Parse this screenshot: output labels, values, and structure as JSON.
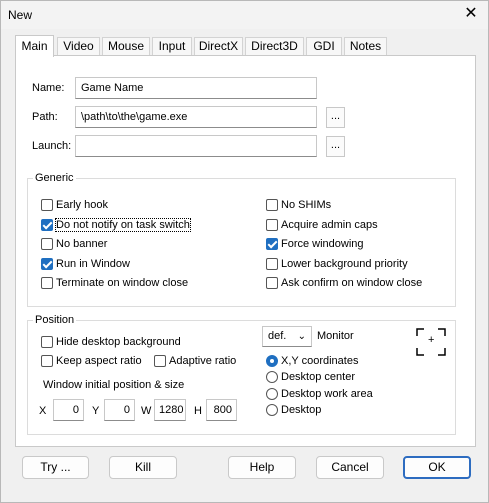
{
  "window": {
    "title": "New",
    "close_symbol": "✕"
  },
  "tabs": [
    "Main",
    "Video",
    "Mouse",
    "Input",
    "DirectX",
    "Direct3D",
    "GDI",
    "Notes"
  ],
  "main": {
    "name_label": "Name:",
    "name_value": "Game Name",
    "path_label": "Path:",
    "path_value": "\\path\\to\\the\\game.exe",
    "launch_label": "Launch:",
    "launch_value": "",
    "browse_label": "..."
  },
  "generic": {
    "title": "Generic",
    "left": [
      {
        "label": "Early hook",
        "checked": false
      },
      {
        "label": "Do not notify on task switch",
        "checked": true
      },
      {
        "label": "No banner",
        "checked": false
      },
      {
        "label": "Run in Window",
        "checked": true
      },
      {
        "label": "Terminate on window close",
        "checked": false
      }
    ],
    "right": [
      {
        "label": "No SHIMs",
        "checked": false
      },
      {
        "label": "Acquire admin caps",
        "checked": false
      },
      {
        "label": "Force windowing",
        "checked": true
      },
      {
        "label": "Lower background priority",
        "checked": false
      },
      {
        "label": "Ask confirm on window close",
        "checked": false
      }
    ]
  },
  "position": {
    "title": "Position",
    "hide_desktop": {
      "label": "Hide desktop background",
      "checked": false
    },
    "keep_aspect": {
      "label": "Keep aspect ratio",
      "checked": false
    },
    "adaptive": {
      "label": "Adaptive ratio",
      "checked": false
    },
    "initial_label": "Window initial position & size",
    "x_label": "X",
    "x_value": "0",
    "y_label": "Y",
    "y_value": "0",
    "w_label": "W",
    "w_value": "1280",
    "h_label": "H",
    "h_value": "800",
    "monitor_select": "def.",
    "monitor_label": "Monitor",
    "radios": [
      {
        "label": "X,Y coordinates",
        "checked": true
      },
      {
        "label": "Desktop center",
        "checked": false
      },
      {
        "label": "Desktop work area",
        "checked": false
      },
      {
        "label": "Desktop",
        "checked": false
      }
    ],
    "crosshair_icon": "crosshair-icon",
    "crosshair_symbol": "+"
  },
  "buttons": {
    "try": "Try ...",
    "kill": "Kill",
    "help": "Help",
    "cancel": "Cancel",
    "ok": "OK"
  },
  "colors": {
    "accent": "#1f6fc1",
    "default_border": "#2d6cc0"
  }
}
